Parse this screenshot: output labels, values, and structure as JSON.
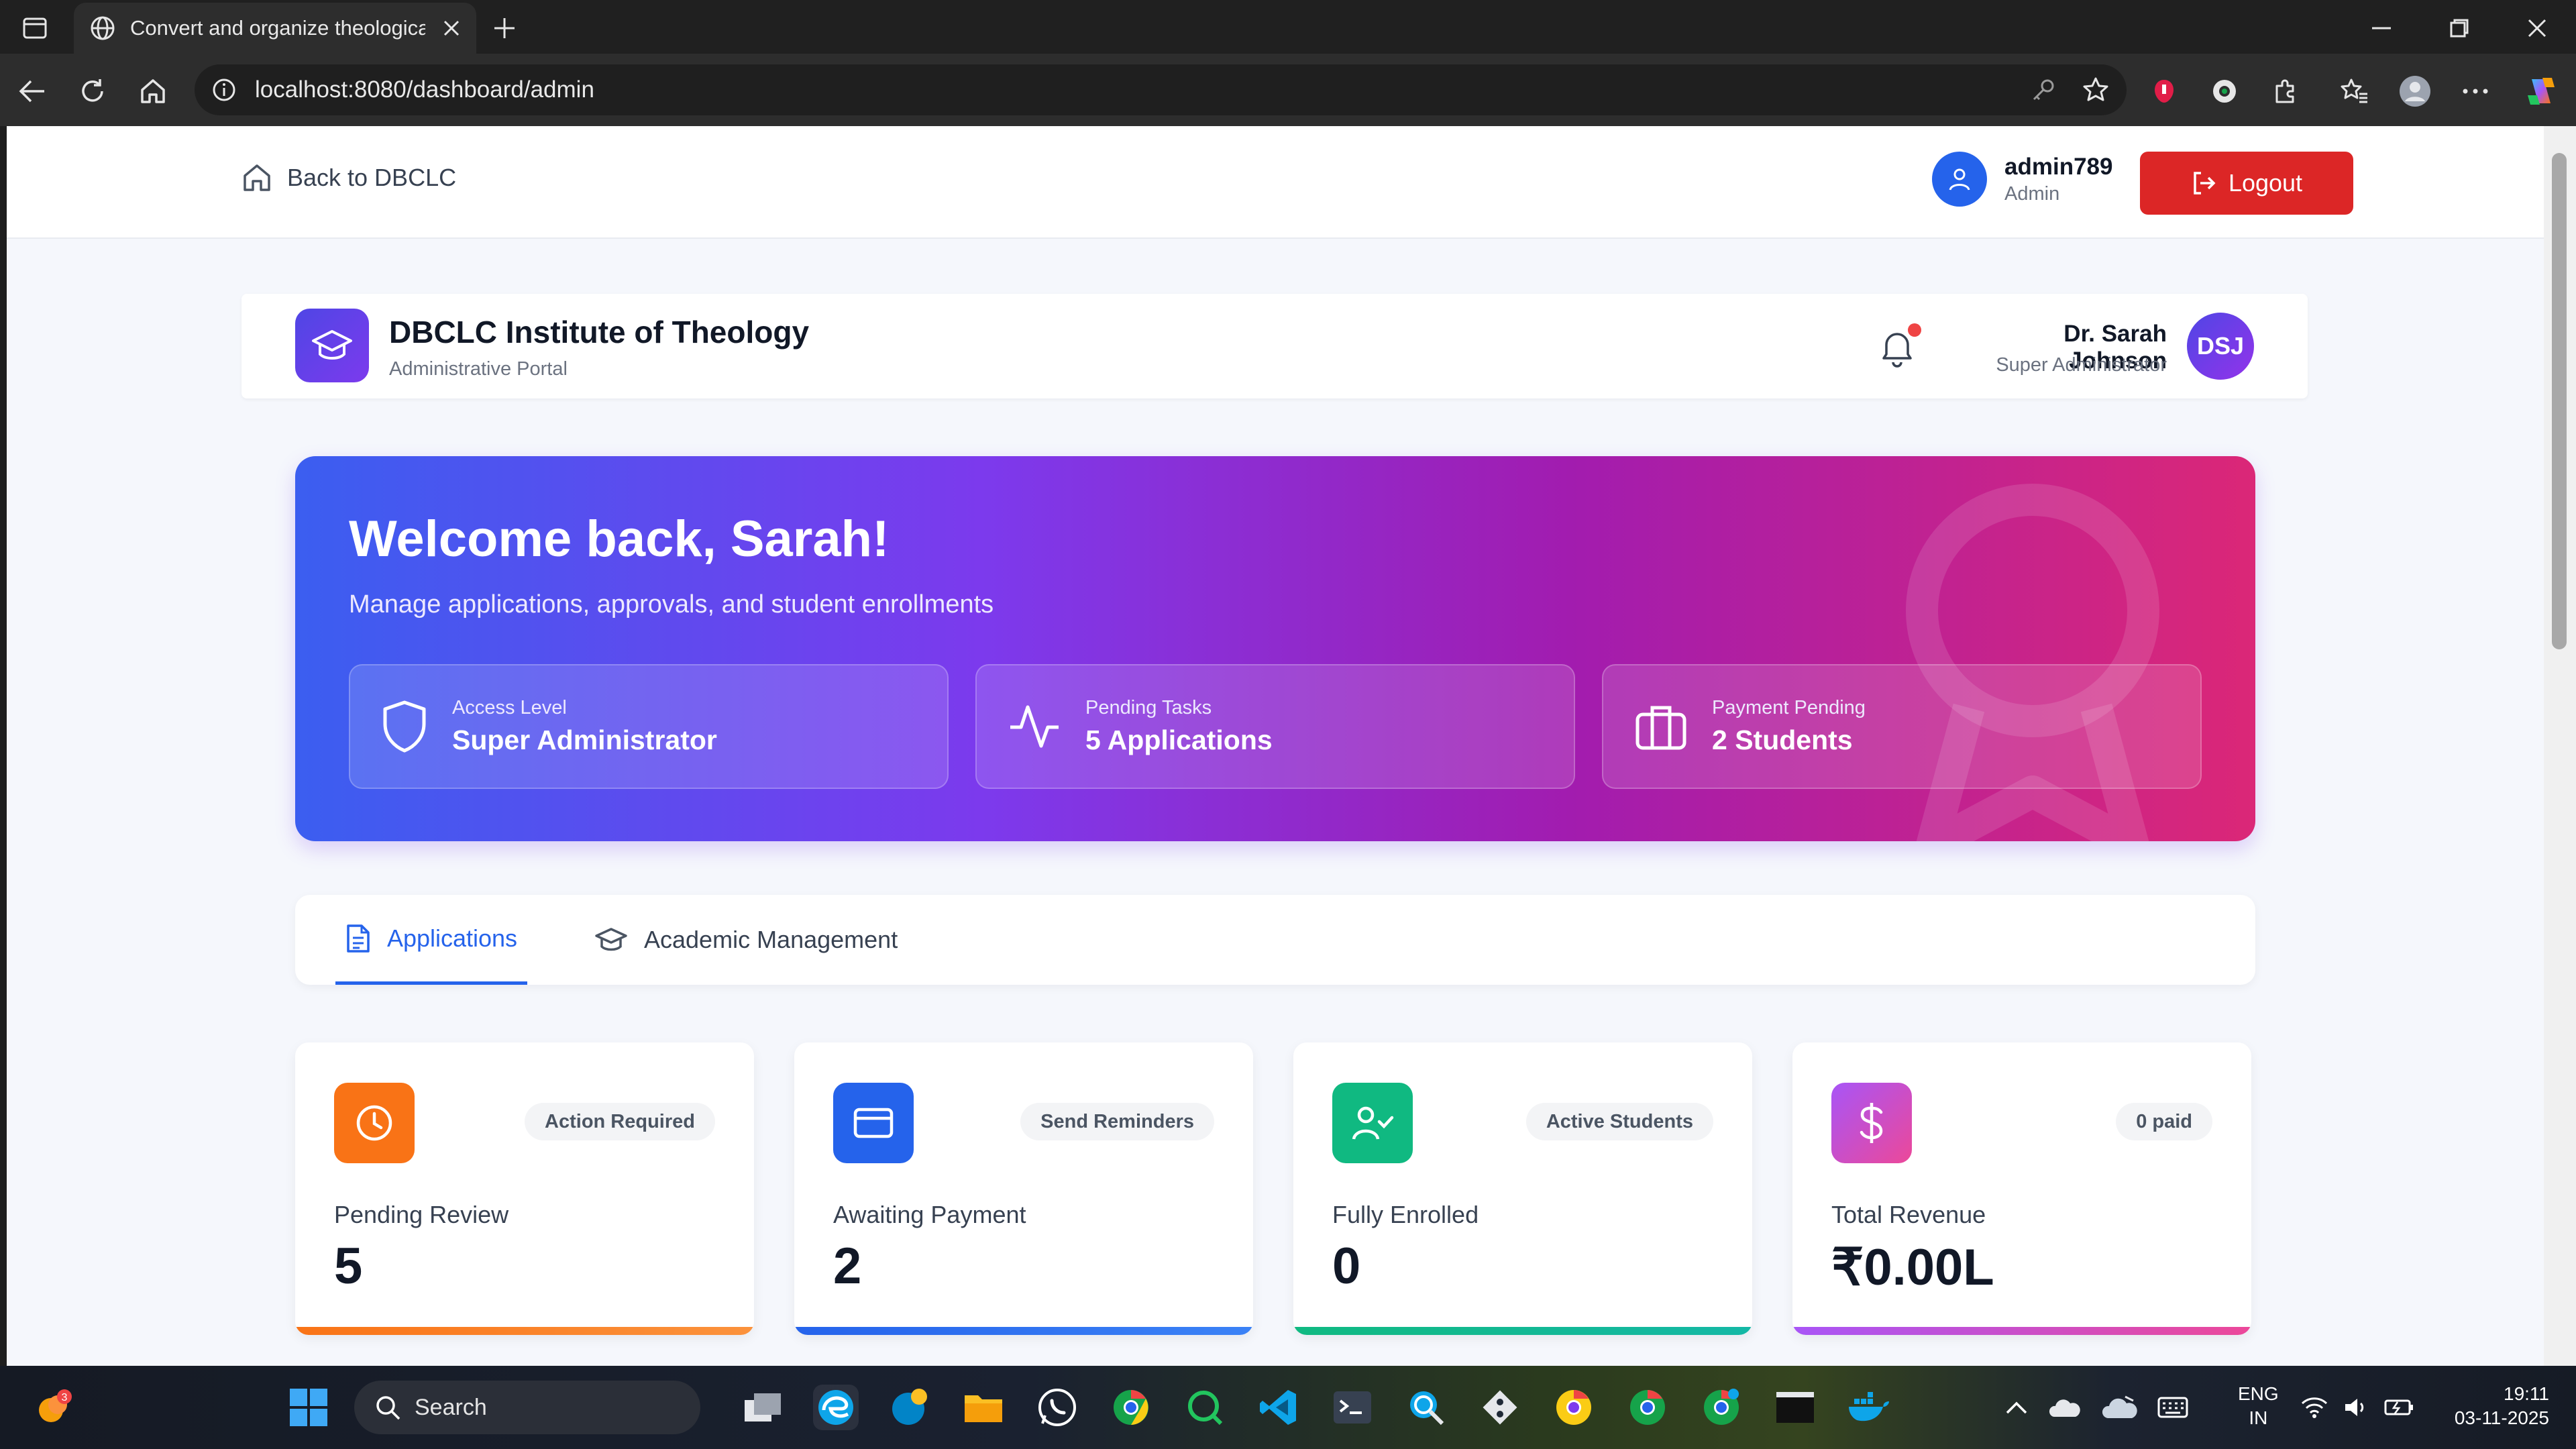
{
  "browser": {
    "tab_title": "Convert and organize theological",
    "url": "localhost:8080/dashboard/admin"
  },
  "app_header": {
    "back_label": "Back to DBCLC",
    "user_name": "admin789",
    "user_role": "Admin",
    "logout_label": "Logout"
  },
  "institute": {
    "title": "DBCLC Institute of Theology",
    "subtitle": "Administrative Portal",
    "admin_name": "Dr. Sarah Johnson",
    "admin_role": "Super Administrator",
    "admin_initials": "DSJ"
  },
  "hero": {
    "title": "Welcome back, Sarah!",
    "subtitle": "Manage applications, approvals, and student enrollments",
    "stats": [
      {
        "label": "Access Level",
        "value": "Super Administrator",
        "icon": "shield-icon"
      },
      {
        "label": "Pending Tasks",
        "value": "5 Applications",
        "icon": "activity-icon"
      },
      {
        "label": "Payment Pending",
        "value": "2 Students",
        "icon": "briefcase-icon"
      }
    ]
  },
  "tabs": [
    {
      "label": "Applications",
      "active": true,
      "icon": "file-text-icon"
    },
    {
      "label": "Academic Management",
      "active": false,
      "icon": "graduation-cap-icon"
    }
  ],
  "cards": [
    {
      "label": "Pending Review",
      "value": "5",
      "badge": "Action Required",
      "icon": "clock-icon",
      "color": "#f97316"
    },
    {
      "label": "Awaiting Payment",
      "value": "2",
      "badge": "Send Reminders",
      "icon": "credit-card-icon",
      "color": "#2563eb"
    },
    {
      "label": "Fully Enrolled",
      "value": "0",
      "badge": "Active Students",
      "icon": "user-check-icon",
      "color": "#10b981"
    },
    {
      "label": "Total Revenue",
      "value": "₹0.00L",
      "badge": "0 paid",
      "icon": "dollar-icon",
      "color": "#d946ef"
    }
  ],
  "taskbar": {
    "search_label": "Search",
    "notification_count": "3",
    "lang_line1": "ENG",
    "lang_line2": "IN",
    "time": "19:11",
    "date": "03-11-2025"
  },
  "colors": {
    "accent": "#2563eb",
    "logout": "#dc2626",
    "hero_start": "#3b5ef0",
    "hero_end": "#db2777"
  }
}
